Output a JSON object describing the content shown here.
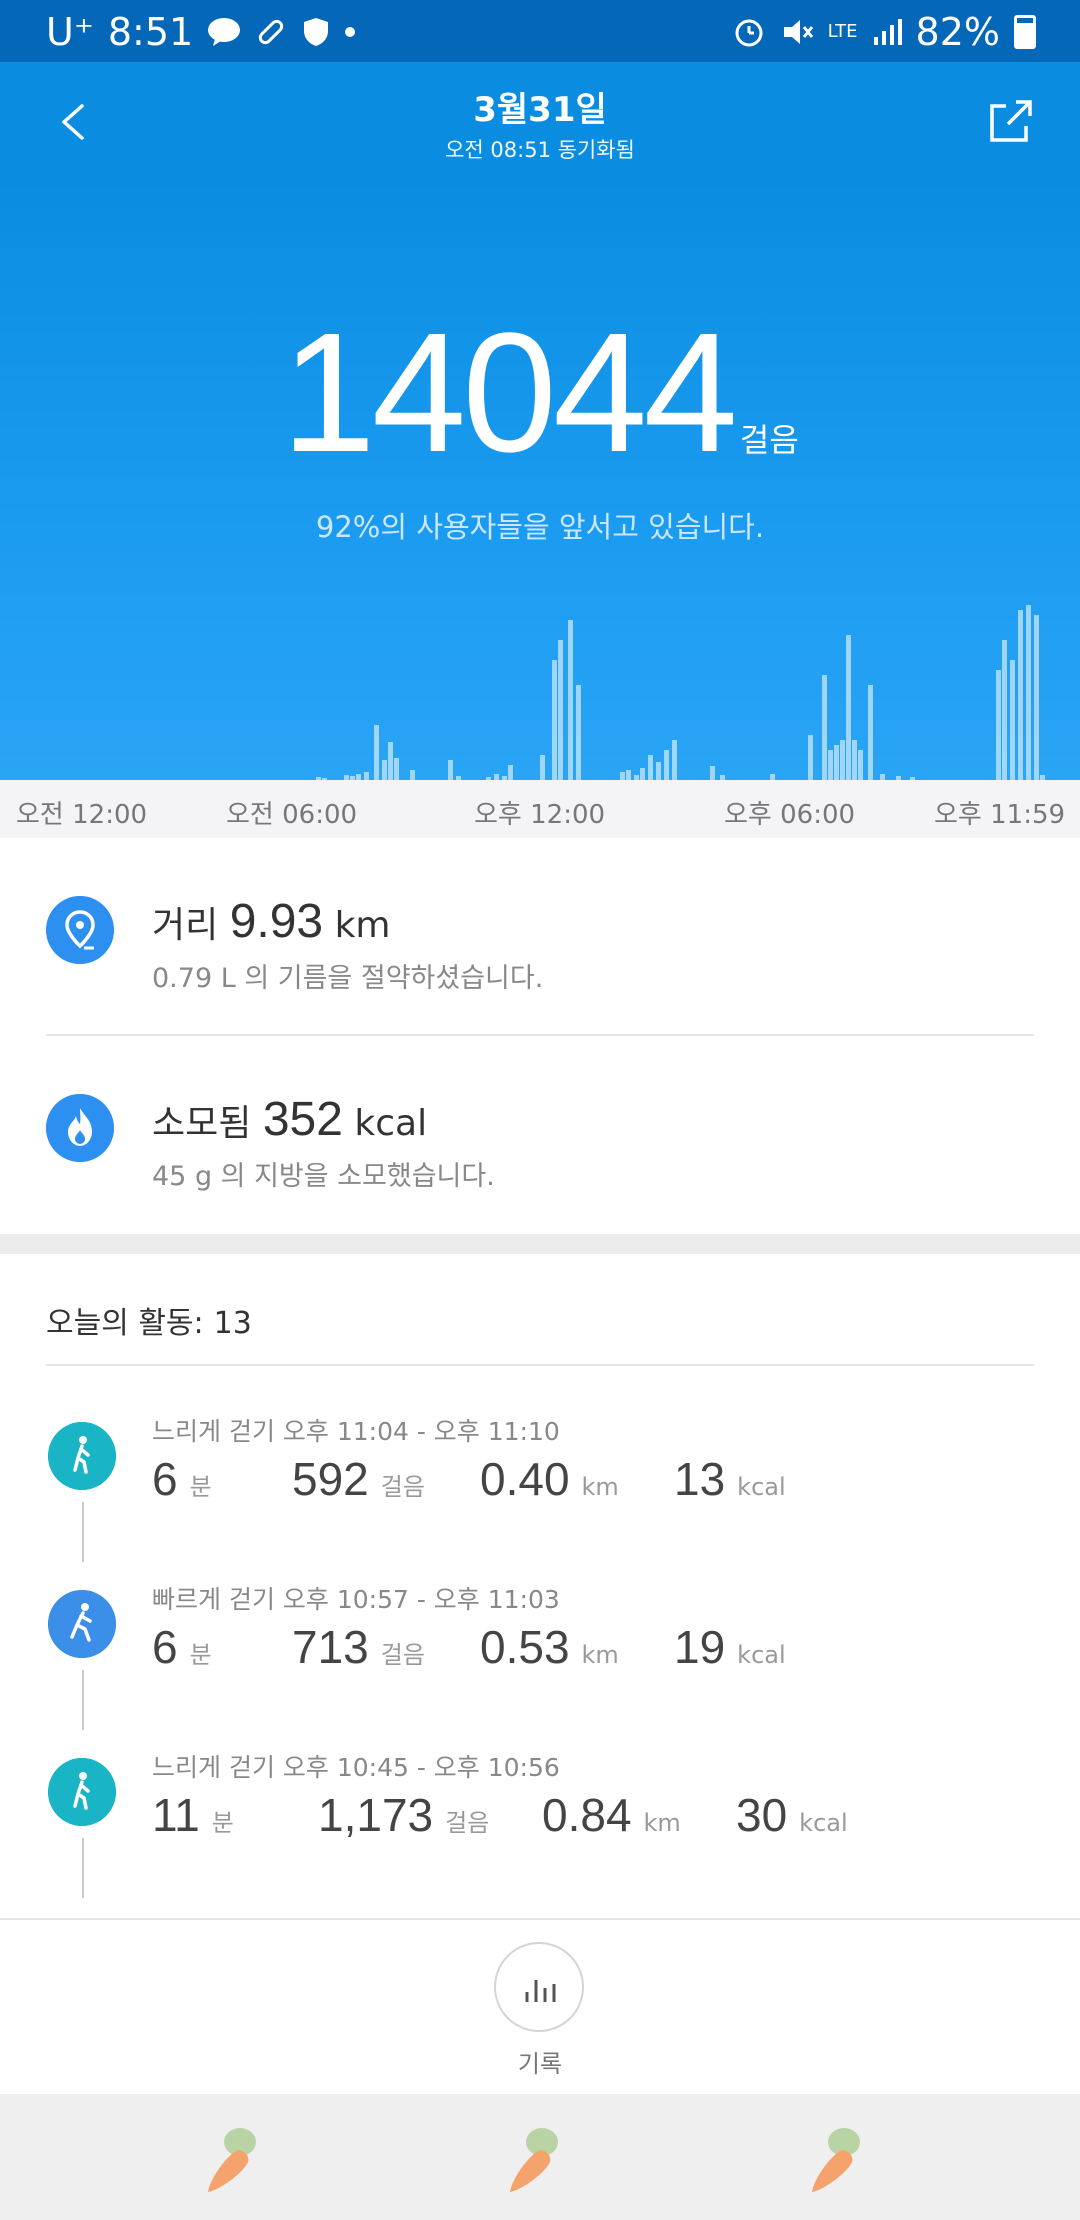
{
  "status_bar": {
    "carrier": "U⁺",
    "time": "8:51",
    "network": "LTE",
    "battery": "82%"
  },
  "header": {
    "title": "3월31일",
    "subtitle": "오전 08:51 동기화됨"
  },
  "hero": {
    "steps": "14044",
    "steps_unit": "걸음",
    "percentile_text": "92%의 사용자들을 앞서고 있습니다.",
    "hourly_bars": [
      0,
      0,
      0,
      0,
      0,
      0,
      0,
      0,
      0,
      0,
      0,
      0,
      0,
      0,
      0,
      0,
      0,
      0,
      0,
      0,
      0,
      0,
      0,
      0,
      0,
      0,
      0,
      0,
      0,
      0,
      0,
      0,
      0,
      0,
      0,
      0,
      0,
      0,
      0,
      0,
      0,
      0,
      0,
      0,
      0,
      0,
      0,
      0,
      0,
      0,
      0,
      0,
      0,
      0,
      0,
      0,
      0,
      0,
      0,
      0,
      0,
      0,
      0,
      0,
      0,
      0,
      0,
      0,
      0,
      0,
      0,
      0,
      0,
      0,
      0,
      0,
      0,
      0,
      3,
      4,
      0,
      0,
      0,
      8,
      6,
      7,
      10,
      0,
      0,
      0,
      0,
      0,
      0,
      0,
      0,
      0,
      0,
      0,
      0,
      0,
      0,
      0,
      0,
      0,
      0,
      0,
      0,
      0,
      0,
      0,
      0,
      0,
      0,
      0,
      0,
      0,
      0,
      2,
      1,
      0,
      0,
      3,
      0,
      0,
      0,
      0,
      0,
      0,
      0,
      0,
      0,
      0,
      0,
      0,
      0,
      0,
      0,
      0,
      0,
      2,
      3,
      2,
      0,
      0,
      0,
      0,
      0,
      0,
      0,
      0,
      0,
      0,
      0,
      0,
      0,
      0,
      0,
      0,
      0,
      0,
      0,
      0,
      0,
      0,
      0,
      0,
      0,
      0,
      0,
      0,
      0,
      0,
      0,
      0,
      0,
      0,
      0,
      0,
      0,
      0,
      0,
      0,
      0,
      0,
      0,
      0,
      0,
      0,
      0,
      0,
      0,
      0,
      0,
      0,
      0,
      0,
      0,
      0,
      0,
      0,
      0,
      0,
      0,
      0,
      0,
      0,
      0,
      0,
      0,
      0,
      0,
      0,
      0,
      0,
      0,
      0,
      0,
      0,
      0,
      0,
      0,
      0,
      0,
      0,
      0,
      0,
      0,
      0,
      0,
      0,
      0,
      0,
      0,
      0,
      0,
      0,
      0,
      0,
      0,
      0,
      0,
      0,
      0,
      0,
      0,
      0,
      0,
      0,
      0
    ]
  },
  "time_axis": {
    "labels": [
      "오전 12:00",
      "오전 06:00",
      "오후 12:00",
      "오후 06:00",
      "오후 11:59"
    ]
  },
  "summary": {
    "distance": {
      "label": "거리",
      "value": "9.93",
      "unit": "km",
      "sub": "0.79 L 의 기름을 절약하셨습니다."
    },
    "calories": {
      "label": "소모됨",
      "value": "352",
      "unit": "kcal",
      "sub": "45 g 의 지방을 소모했습니다."
    }
  },
  "activities": {
    "title": "오늘의 활동:",
    "count": "13",
    "items": [
      {
        "label": "느리게 걷기 오후 11:04 - 오후 11:10",
        "minutes": "6",
        "minutes_unit": "분",
        "steps": "592",
        "steps_unit": "걸음",
        "distance": "0.40",
        "distance_unit": "km",
        "kcal": "13",
        "kcal_unit": "kcal"
      },
      {
        "label": "빠르게 걷기 오후 10:57 - 오후 11:03",
        "minutes": "6",
        "minutes_unit": "분",
        "steps": "713",
        "steps_unit": "걸음",
        "distance": "0.53",
        "distance_unit": "km",
        "kcal": "19",
        "kcal_unit": "kcal"
      },
      {
        "label": "느리게 걷기 오후 10:45 - 오후 10:56",
        "minutes": "11",
        "minutes_unit": "분",
        "steps": "1,173",
        "steps_unit": "걸음",
        "distance": "0.84",
        "distance_unit": "km",
        "kcal": "30",
        "kcal_unit": "kcal"
      }
    ]
  },
  "bottom": {
    "record_label": "기록"
  },
  "colors": {
    "status_bar": "#0467b7",
    "header": "#0a8de1",
    "accent": "#2d8ff0",
    "walk_slow": "#19b4c6",
    "walk_fast": "#3b8fe8"
  }
}
